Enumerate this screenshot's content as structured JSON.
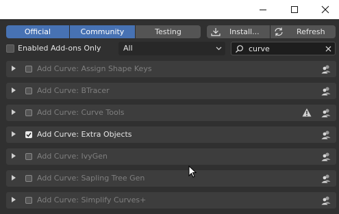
{
  "window": {
    "minimize_glyph": "minimize-icon",
    "maximize_glyph": "maximize-icon",
    "close_glyph": "close-icon"
  },
  "tabs": [
    {
      "label": "Official",
      "active": true
    },
    {
      "label": "Community",
      "active": true
    },
    {
      "label": "Testing",
      "active": false
    }
  ],
  "actions": {
    "install_label": "Install...",
    "refresh_label": "Refresh"
  },
  "filter": {
    "enabled_only_label": "Enabled Add-ons Only",
    "enabled_only_checked": false,
    "category_value": "All",
    "search_value": "curve"
  },
  "addons": [
    {
      "name": "Add Curve: Assign Shape Keys",
      "enabled": false,
      "warning": false
    },
    {
      "name": "Add Curve: BTracer",
      "enabled": false,
      "warning": false
    },
    {
      "name": "Add Curve: Curve Tools",
      "enabled": false,
      "warning": true
    },
    {
      "name": "Add Curve: Extra Objects",
      "enabled": true,
      "warning": false
    },
    {
      "name": "Add Curve: IvyGen",
      "enabled": false,
      "warning": false
    },
    {
      "name": "Add Curve: Sapling Tree Gen",
      "enabled": false,
      "warning": false
    },
    {
      "name": "Add Curve: Simplify Curves+",
      "enabled": false,
      "warning": false
    }
  ],
  "colors": {
    "accent": "#4772b3",
    "background": "#303030",
    "row": "#3d3d3d"
  }
}
